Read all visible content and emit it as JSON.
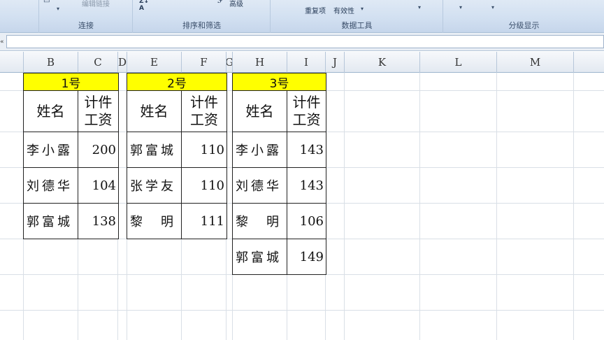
{
  "ribbon": {
    "groups": [
      {
        "title": "连接"
      },
      {
        "title": "排序和筛选"
      },
      {
        "title": "数据工具"
      },
      {
        "title": "分级显示"
      }
    ],
    "edit_links_label": "编辑链接",
    "advanced_label": "高级",
    "remove_duplicates_label": "重复项",
    "validation_label": "有效性"
  },
  "columns": [
    "B",
    "C",
    "D",
    "E",
    "F",
    "G",
    "H",
    "I",
    "J",
    "K",
    "L",
    "M"
  ],
  "tables": [
    {
      "title": "1号",
      "headers": {
        "name": "姓名",
        "wage": "计件\n工资"
      },
      "rows": [
        {
          "name": "李小露",
          "value": "200"
        },
        {
          "name": "刘德华",
          "value": "104"
        },
        {
          "name": "郭富城",
          "value": "138"
        }
      ]
    },
    {
      "title": "2号",
      "headers": {
        "name": "姓名",
        "wage": "计件\n工资"
      },
      "rows": [
        {
          "name": "郭富城",
          "value": "110"
        },
        {
          "name": "张学友",
          "value": "110"
        },
        {
          "name": "黎　明",
          "value": "111"
        }
      ]
    },
    {
      "title": "3号",
      "headers": {
        "name": "姓名",
        "wage": "计件\n工资"
      },
      "rows": [
        {
          "name": "李小露",
          "value": "143"
        },
        {
          "name": "刘德华",
          "value": "143"
        },
        {
          "name": "黎　明",
          "value": "106"
        },
        {
          "name": "郭富城",
          "value": "149"
        }
      ]
    }
  ]
}
